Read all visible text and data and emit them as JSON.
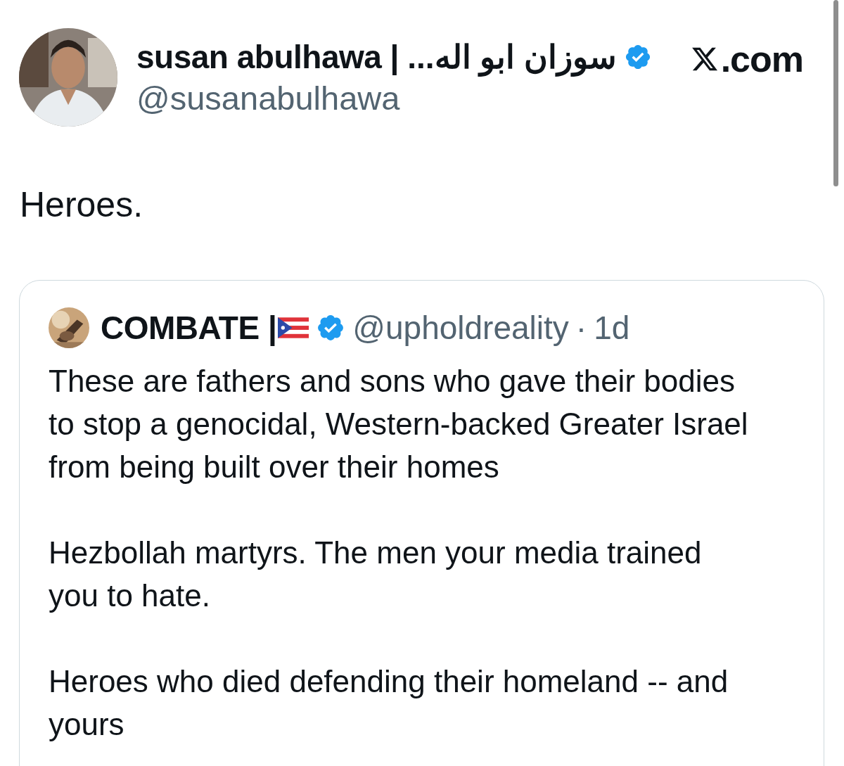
{
  "author": {
    "name": "susan abulhawa |",
    "name_arabic": "سوزان ابو اله...",
    "verified": true,
    "handle": "@susanabulhawa"
  },
  "site": {
    "label": ".com"
  },
  "post": {
    "text": "Heroes."
  },
  "quote": {
    "author": {
      "name": "COMBATE |",
      "verified": true,
      "handle": "@upholdreality",
      "separator": "·",
      "time": "1d"
    },
    "paragraphs": [
      "These are fathers and sons who gave their bodies to stop a genocidal, Western-backed Greater Israel from being built over their homes",
      "Hezbollah martyrs. The men your media trained you to hate.",
      "Heroes who died defending their homeland -- and yours"
    ]
  }
}
